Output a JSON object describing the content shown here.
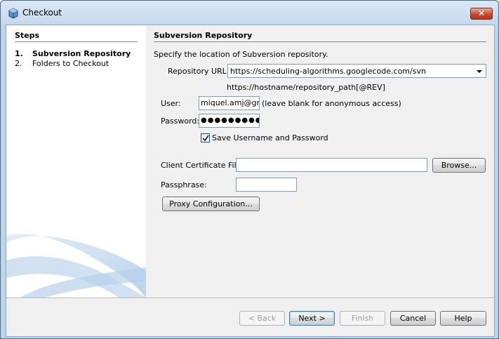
{
  "window": {
    "title": "Checkout",
    "close_label": "✕"
  },
  "steps": {
    "title": "Steps",
    "items": [
      {
        "num": "1.",
        "label": "Subversion Repository",
        "active": true
      },
      {
        "num": "2.",
        "label": "Folders to Checkout",
        "active": false
      }
    ]
  },
  "panel": {
    "title": "Subversion Repository",
    "description": "Specify the location of Subversion repository.",
    "repository_url_label": "Repository URL:",
    "repository_url_value": "https://scheduling-algorithms.googlecode.com/svn",
    "url_hint": "https://hostname/repository_path[@REV]",
    "user_label": "User:",
    "user_value": "miquel.amj@gma",
    "user_hint": "(leave blank for anonymous access)",
    "password_label": "Password:",
    "password_value": "●●●●●●●●●●●●●",
    "save_credentials_label": "Save Username and Password",
    "save_credentials_checked": true,
    "client_cert_label": "Client Certificate File:",
    "client_cert_value": "",
    "browse_label": "Browse...",
    "passphrase_label": "Passphrase:",
    "passphrase_value": "",
    "proxy_label": "Proxy Configuration..."
  },
  "footer": {
    "back_label": "< Back",
    "next_label": "Next >",
    "finish_label": "Finish",
    "cancel_label": "Cancel",
    "help_label": "Help"
  }
}
